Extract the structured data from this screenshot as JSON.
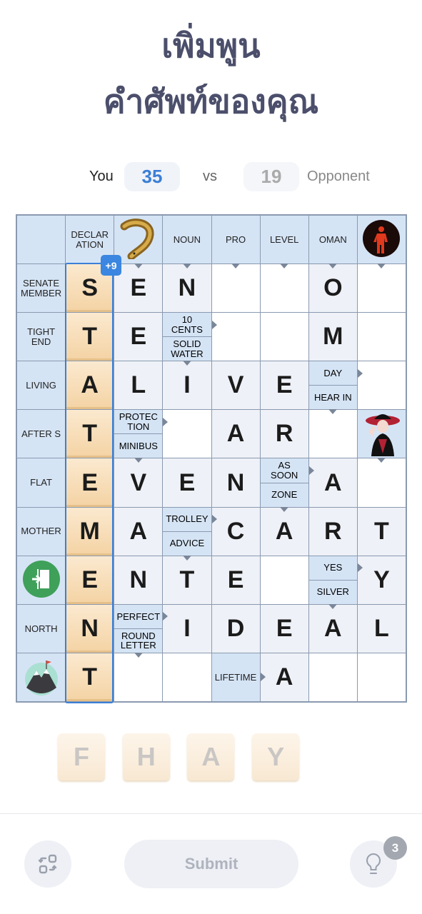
{
  "title": {
    "line1": "เพิ่มพูน",
    "line2": "คำศัพท์ของคุณ"
  },
  "score": {
    "you_label": "You",
    "you_score": "35",
    "vs": "vs",
    "opponent_score": "19",
    "opponent_label": "Opponent"
  },
  "colors": {
    "accent": "#3b7fd6",
    "clue_bg": "#d5e4f5",
    "tile": "#f4d3a4"
  },
  "word_bonus": "+9",
  "grid": [
    [
      {
        "t": "clue",
        "v": ""
      },
      {
        "t": "clue",
        "v": "DECLAR\nATION"
      },
      {
        "t": "img",
        "v": "eel-image",
        "a": "d"
      },
      {
        "t": "clue",
        "v": "NOUN",
        "a": "d"
      },
      {
        "t": "clue",
        "v": "PRO",
        "a": "d"
      },
      {
        "t": "clue",
        "v": "LEVEL",
        "a": "d"
      },
      {
        "t": "clue",
        "v": "OMAN",
        "a": "d"
      },
      {
        "t": "img",
        "v": "traffic-light-image",
        "a": "d"
      }
    ],
    [
      {
        "t": "clue",
        "v": "SENATE\nMEMBER"
      },
      {
        "t": "tile",
        "v": "S"
      },
      {
        "t": "letter",
        "v": "E"
      },
      {
        "t": "letter",
        "v": "N"
      },
      {
        "t": "empty"
      },
      {
        "t": "empty"
      },
      {
        "t": "letter",
        "v": "O"
      },
      {
        "t": "empty"
      }
    ],
    [
      {
        "t": "clue",
        "v": "TIGHT\nEND"
      },
      {
        "t": "tile",
        "v": "T"
      },
      {
        "t": "letter",
        "v": "E"
      },
      {
        "t": "split",
        "v": "10\nCENTS",
        "w": "SOLID\nWATER"
      },
      {
        "t": "empty"
      },
      {
        "t": "empty"
      },
      {
        "t": "letter",
        "v": "M"
      },
      {
        "t": "empty"
      }
    ],
    [
      {
        "t": "clue",
        "v": "LIVING"
      },
      {
        "t": "tile",
        "v": "A"
      },
      {
        "t": "letter",
        "v": "L"
      },
      {
        "t": "letter",
        "v": "I"
      },
      {
        "t": "letter",
        "v": "V"
      },
      {
        "t": "letter",
        "v": "E"
      },
      {
        "t": "split",
        "v": "DAY",
        "w": "HEAR IN"
      },
      {
        "t": "empty"
      }
    ],
    [
      {
        "t": "clue",
        "v": "AFTER S"
      },
      {
        "t": "tile",
        "v": "T"
      },
      {
        "t": "split",
        "v": "PROTEC\nTION",
        "w": "MINIBUS"
      },
      {
        "t": "empty"
      },
      {
        "t": "letter",
        "v": "A"
      },
      {
        "t": "letter",
        "v": "R"
      },
      {
        "t": "empty"
      },
      {
        "t": "img",
        "v": "woman-hat-image",
        "a": "d"
      }
    ],
    [
      {
        "t": "clue",
        "v": "FLAT"
      },
      {
        "t": "tile",
        "v": "E"
      },
      {
        "t": "letter",
        "v": "V"
      },
      {
        "t": "letter",
        "v": "E"
      },
      {
        "t": "letter",
        "v": "N"
      },
      {
        "t": "split",
        "v": "AS\nSOON",
        "w": "ZONE"
      },
      {
        "t": "letter",
        "v": "A"
      },
      {
        "t": "empty"
      }
    ],
    [
      {
        "t": "clue",
        "v": "MOTHER"
      },
      {
        "t": "tile",
        "v": "M"
      },
      {
        "t": "letter",
        "v": "A"
      },
      {
        "t": "split",
        "v": "TROLLEY",
        "w": "ADVICE"
      },
      {
        "t": "letter",
        "v": "C"
      },
      {
        "t": "letter",
        "v": "A"
      },
      {
        "t": "letter",
        "v": "R"
      },
      {
        "t": "letter",
        "v": "T"
      }
    ],
    [
      {
        "t": "img",
        "v": "exit-door-image"
      },
      {
        "t": "tile",
        "v": "E"
      },
      {
        "t": "letter",
        "v": "N"
      },
      {
        "t": "letter",
        "v": "T"
      },
      {
        "t": "letter",
        "v": "E"
      },
      {
        "t": "empty"
      },
      {
        "t": "split",
        "v": "YES",
        "w": "SILVER"
      },
      {
        "t": "letter",
        "v": "Y"
      }
    ],
    [
      {
        "t": "clue",
        "v": "NORTH"
      },
      {
        "t": "tile",
        "v": "N"
      },
      {
        "t": "split",
        "v": "PERFECT",
        "w": "ROUND\nLETTER"
      },
      {
        "t": "letter",
        "v": "I"
      },
      {
        "t": "letter",
        "v": "D"
      },
      {
        "t": "letter",
        "v": "E"
      },
      {
        "t": "letter",
        "v": "A"
      },
      {
        "t": "letter",
        "v": "L"
      }
    ],
    [
      {
        "t": "img",
        "v": "mountain-image"
      },
      {
        "t": "tile",
        "v": "T"
      },
      {
        "t": "empty"
      },
      {
        "t": "empty"
      },
      {
        "t": "clue",
        "v": "LIFETIME",
        "a": "r"
      },
      {
        "t": "letter",
        "v": "A"
      },
      {
        "t": "empty"
      },
      {
        "t": "empty"
      }
    ]
  ],
  "rack": [
    "F",
    "H",
    "A",
    "Y"
  ],
  "controls": {
    "submit_label": "Submit",
    "hint_count": "3",
    "shuffle_icon": "shuffle-icon",
    "hint_icon": "lightbulb-icon"
  }
}
